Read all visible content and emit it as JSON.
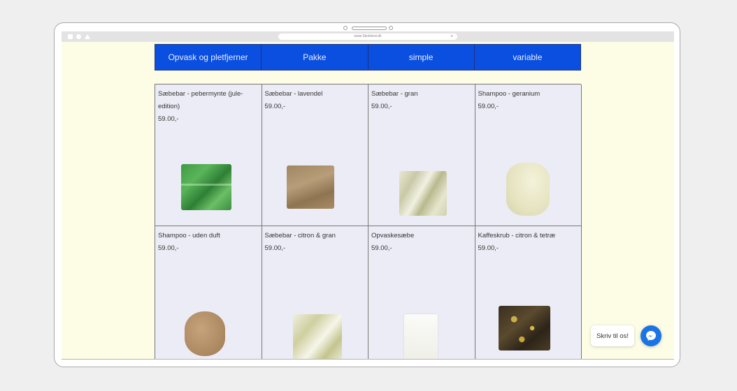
{
  "browser": {
    "url": "www.Skoletest.dk"
  },
  "categories": [
    {
      "label": "Opvask og pletfjerner"
    },
    {
      "label": "Pakke"
    },
    {
      "label": "simple"
    },
    {
      "label": "variable"
    }
  ],
  "products": [
    {
      "name": "Sæbebar - pebermynte (jule-edition)",
      "price": "59.00,-"
    },
    {
      "name": "Sæbebar - lavendel",
      "price": "59.00,-"
    },
    {
      "name": "Sæbebar - gran",
      "price": "59.00,-"
    },
    {
      "name": "Shampoo - geranium",
      "price": "59.00,-"
    },
    {
      "name": "Shampoo - uden duft",
      "price": "59.00,-"
    },
    {
      "name": "Sæbebar - citron & gran",
      "price": "59.00,-"
    },
    {
      "name": "Opvaskesæbe",
      "price": "59.00,-"
    },
    {
      "name": "Kaffeskrub - citron & tetræ",
      "price": "59.00,-"
    }
  ],
  "chat": {
    "label": "Skriv til os!",
    "icon": "messenger-icon"
  },
  "colors": {
    "page_bg": "#fdfde6",
    "nav_bg": "#0b4fe0",
    "card_bg": "#ececf7",
    "chat_button": "#1b74e4"
  }
}
